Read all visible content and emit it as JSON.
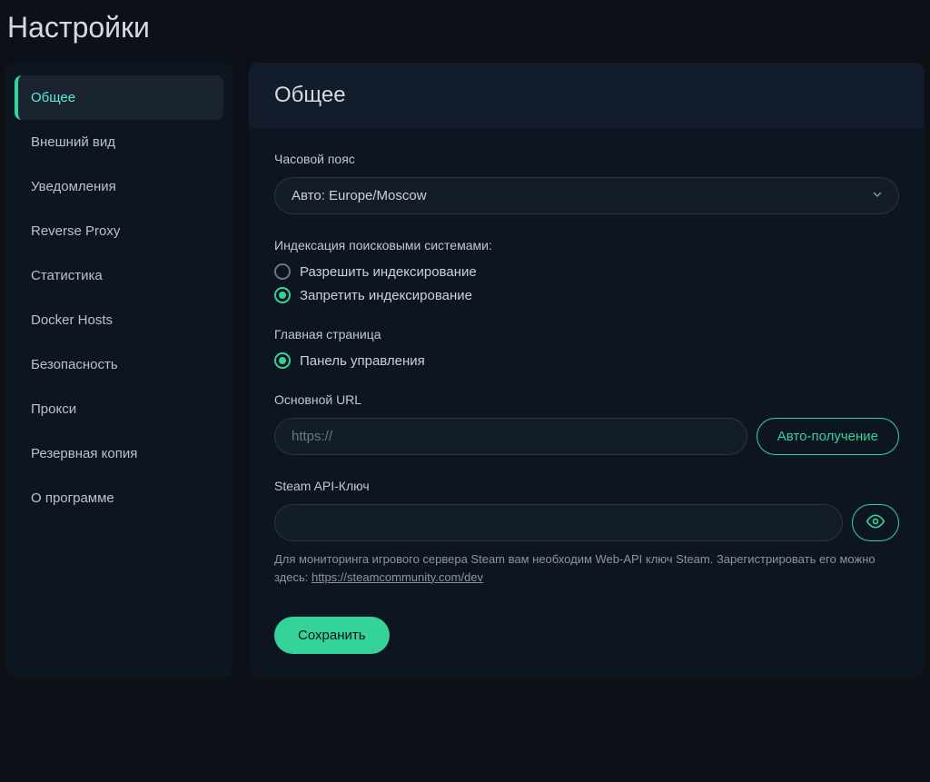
{
  "page_title": "Настройки",
  "sidebar": {
    "items": [
      {
        "label": "Общее",
        "active": true
      },
      {
        "label": "Внешний вид",
        "active": false
      },
      {
        "label": "Уведомления",
        "active": false
      },
      {
        "label": "Reverse Proxy",
        "active": false
      },
      {
        "label": "Статистика",
        "active": false
      },
      {
        "label": "Docker Hosts",
        "active": false
      },
      {
        "label": "Безопасность",
        "active": false
      },
      {
        "label": "Прокси",
        "active": false
      },
      {
        "label": "Резервная копия",
        "active": false
      },
      {
        "label": "О программе",
        "active": false
      }
    ]
  },
  "content": {
    "title": "Общее",
    "timezone": {
      "label": "Часовой пояс",
      "value": "Авто: Europe/Moscow"
    },
    "indexing": {
      "label": "Индексация поисковыми системами:",
      "options": [
        {
          "label": "Разрешить индексирование",
          "checked": false
        },
        {
          "label": "Запретить индексирование",
          "checked": true
        }
      ]
    },
    "entry_page": {
      "label": "Главная страница",
      "options": [
        {
          "label": "Панель управления",
          "checked": true
        }
      ]
    },
    "primary_url": {
      "label": "Основной URL",
      "placeholder": "https://",
      "auto_button": "Авто-получение"
    },
    "steam_api": {
      "label": "Steam API-Ключ",
      "help_prefix": "Для мониторинга игрового сервера Steam вам необходим Web-API ключ Steam. Зарегистрировать его можно здесь: ",
      "help_link": "https://steamcommunity.com/dev"
    },
    "save_button": "Сохранить"
  },
  "colors": {
    "accent": "#34d399",
    "bg": "#0d1117",
    "panel": "#0d1521"
  }
}
